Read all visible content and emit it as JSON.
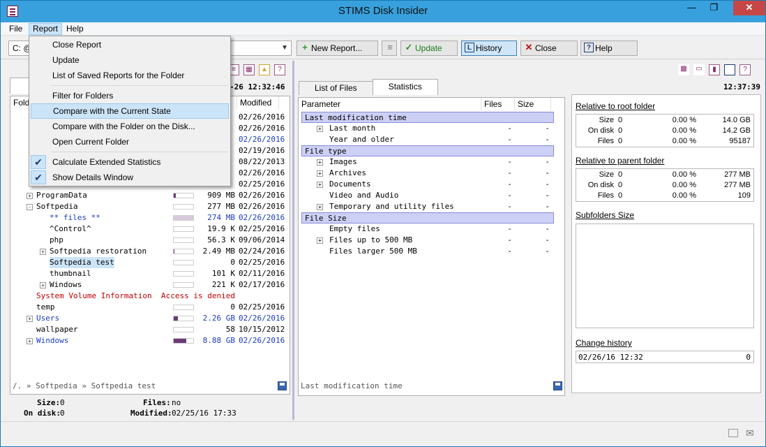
{
  "window": {
    "title": "STIMS Disk Insider"
  },
  "menu": {
    "file": "File",
    "report": "Report",
    "help": "Help"
  },
  "report_menu": {
    "items": [
      "Close Report",
      "Update",
      "List of Saved Reports for the Folder",
      "Filter for Folders",
      "Compare with the Current State",
      "Compare with the Folder on the Disk...",
      "Open Current Folder",
      "Calculate Extended Statistics",
      "Show Details Window"
    ]
  },
  "toolbar": {
    "drive": "C: @",
    "new_report": "New Report...",
    "update": "Update",
    "history": "History",
    "close": "Close",
    "help": "Help"
  },
  "left": {
    "time": "-26 12:32:46",
    "col_folder": "Fold",
    "col_modified": "Modified",
    "rows": [
      {
        "name": "",
        "size": "",
        "date": "02/26/2016"
      },
      {
        "name": "",
        "size": "",
        "date": "02/26/2016"
      },
      {
        "name": "",
        "size": "",
        "date": "02/26/2016"
      },
      {
        "name": "",
        "size": "",
        "date": "02/19/2016"
      },
      {
        "name": "",
        "size": "",
        "date": "08/22/2013"
      },
      {
        "name": "",
        "size": "",
        "date": "02/26/2016"
      },
      {
        "name": "",
        "size": "",
        "date": "02/25/2016"
      },
      {
        "name": "ProgramData",
        "size": "909 MB",
        "date": "02/26/2016"
      },
      {
        "name": "Softpedia",
        "size": "277 MB",
        "date": "02/26/2016"
      },
      {
        "name": "** files **",
        "size": "274 MB",
        "date": "02/26/2016"
      },
      {
        "name": "^Control^",
        "size": "19.9 K",
        "date": "02/25/2016"
      },
      {
        "name": "php",
        "size": "56.3 K",
        "date": "09/06/2014"
      },
      {
        "name": "Softpedia restoration",
        "size": "2.49 MB",
        "date": "02/24/2016"
      },
      {
        "name": "Softpedia test",
        "size": "0",
        "date": "02/25/2016"
      },
      {
        "name": "thumbnail",
        "size": "101 K",
        "date": "02/11/2016"
      },
      {
        "name": "Windows",
        "size": "221 K",
        "date": "02/17/2016"
      },
      {
        "name": "System Volume Information",
        "size": "Access is denied",
        "date": ""
      },
      {
        "name": "temp",
        "size": "0",
        "date": "02/25/2016"
      },
      {
        "name": "Users",
        "size": "2.26 GB",
        "date": "02/26/2016"
      },
      {
        "name": "wallpaper",
        "size": "58",
        "date": "10/15/2012"
      },
      {
        "name": "Windows",
        "size": "8.88 GB",
        "date": "02/26/2016"
      }
    ],
    "bar_levels": [
      0,
      0,
      0,
      0,
      0,
      0,
      0,
      0.1,
      0,
      1.0,
      0,
      0,
      0.05,
      0,
      0,
      0,
      0,
      0,
      0.2,
      0,
      0.65
    ],
    "path": "/. » Softpedia » Softpedia test",
    "summary": {
      "size_label": "Size:",
      "size_value": "0",
      "files_label": "Files:",
      "files_value": "no",
      "ondisk_label": "On disk:",
      "ondisk_value": "0",
      "modified_label": "Modified:",
      "modified_value": "02/25/16 17:33"
    }
  },
  "middle": {
    "tab_list": "List of Files",
    "tab_stats": "Statistics",
    "time": "12:37:39",
    "col_parameter": "Parameter",
    "col_files": "Files",
    "col_size": "Size",
    "rows": [
      {
        "label": "Last modification time",
        "files": "",
        "size": ""
      },
      {
        "label": "Last month",
        "files": "-",
        "size": "-"
      },
      {
        "label": "Year and older",
        "files": "-",
        "size": "-"
      },
      {
        "label": "File type",
        "files": "",
        "size": ""
      },
      {
        "label": "Images",
        "files": "-",
        "size": "-"
      },
      {
        "label": "Archives",
        "files": "-",
        "size": "-"
      },
      {
        "label": "Documents",
        "files": "-",
        "size": "-"
      },
      {
        "label": "Video and Audio",
        "files": "-",
        "size": "-"
      },
      {
        "label": "Temporary and utility files",
        "files": "-",
        "size": "-"
      },
      {
        "label": "File Size",
        "files": "",
        "size": ""
      },
      {
        "label": "Empty files",
        "files": "-",
        "size": "-"
      },
      {
        "label": "Files up to 500 MB",
        "files": "-",
        "size": "-"
      },
      {
        "label": "Files larger 500 MB",
        "files": "-",
        "size": "-"
      }
    ],
    "status": "Last modification time"
  },
  "right": {
    "root_title": "Relative to root folder",
    "root": [
      {
        "label": "Size",
        "n": "0",
        "pct": "0.00 %",
        "value": "14.0 GB"
      },
      {
        "label": "On disk",
        "n": "0",
        "pct": "0.00 %",
        "value": "14.2 GB"
      },
      {
        "label": "Files",
        "n": "0",
        "pct": "0.00 %",
        "value": "95187"
      }
    ],
    "parent_title": "Relative to parent folder",
    "parent": [
      {
        "label": "Size",
        "n": "0",
        "pct": "0.00 %",
        "value": "277 MB"
      },
      {
        "label": "On disk",
        "n": "0",
        "pct": "0.00 %",
        "value": "277 MB"
      },
      {
        "label": "Files",
        "n": "0",
        "pct": "0.00 %",
        "value": "109"
      }
    ],
    "subfolders_title": "Subfolders Size",
    "history_title": "Change history",
    "history": {
      "date": "02/26/16 12:32",
      "value": "0"
    }
  }
}
